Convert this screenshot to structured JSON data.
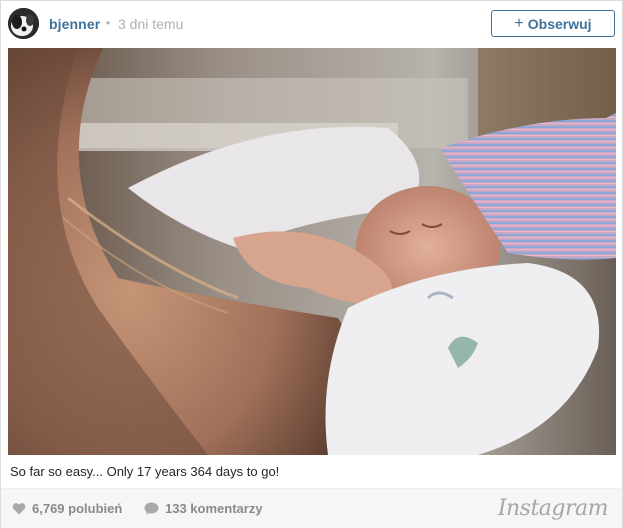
{
  "post": {
    "username": "bjenner",
    "separator": "•",
    "time_ago": "3 dni temu",
    "follow": {
      "icon": "+",
      "label": "Obserwuj"
    },
    "photo_subject": "newborn-baby-photo",
    "caption": "So far so easy... Only 17 years 364 days to go!"
  },
  "footer": {
    "likes_label": "6,769 polubień",
    "comments_label": "133 komentarzy",
    "brand": "Instagram"
  },
  "colors": {
    "link_blue": "#3f729b",
    "muted_gray": "#b0b0b0",
    "footer_bg": "#f6f6f6"
  }
}
